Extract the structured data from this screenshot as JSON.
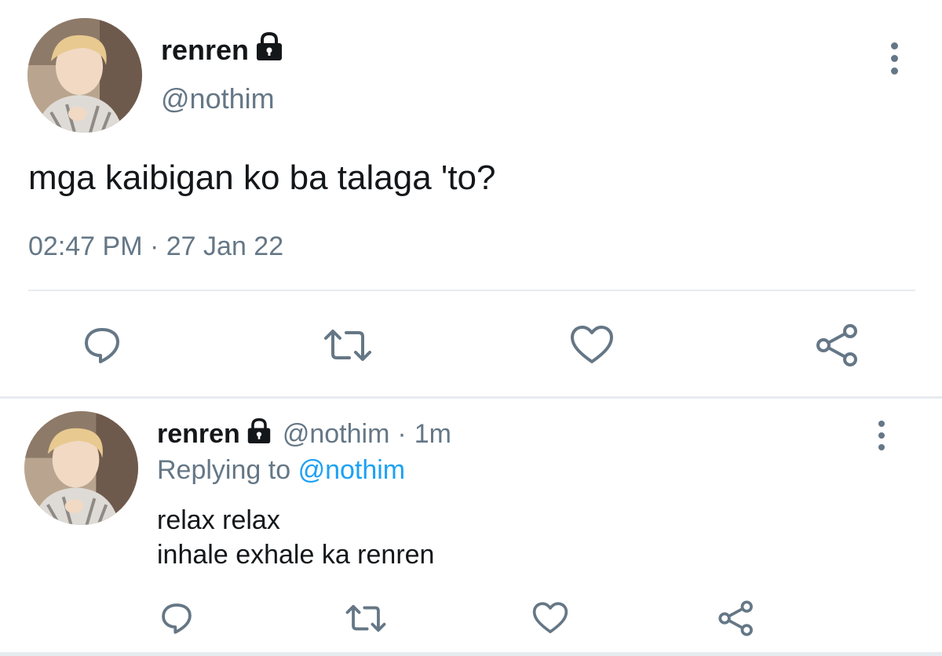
{
  "main_tweet": {
    "display_name": "renren",
    "handle": "@nothim",
    "text": "mga kaibigan ko ba talaga 'to?",
    "time": "02:47 PM",
    "separator": "·",
    "date": "27 Jan 22",
    "icons": {
      "lock": "lock-icon",
      "menu": "more-vertical-icon",
      "reply": "reply-bubble-icon",
      "retweet": "retweet-icon",
      "like": "heart-icon",
      "share": "share-icon"
    }
  },
  "reply_tweet": {
    "display_name": "renren",
    "handle": "@nothim",
    "separator": "·",
    "time_ago": "1m",
    "replying_prefix": "Replying to",
    "replying_to": "@nothim",
    "line1": "relax relax",
    "line2": "inhale exhale ka renren"
  },
  "colors": {
    "text": "#14171a",
    "muted": "#657786",
    "link": "#1da1f2",
    "divider": "#e6ecf0"
  }
}
